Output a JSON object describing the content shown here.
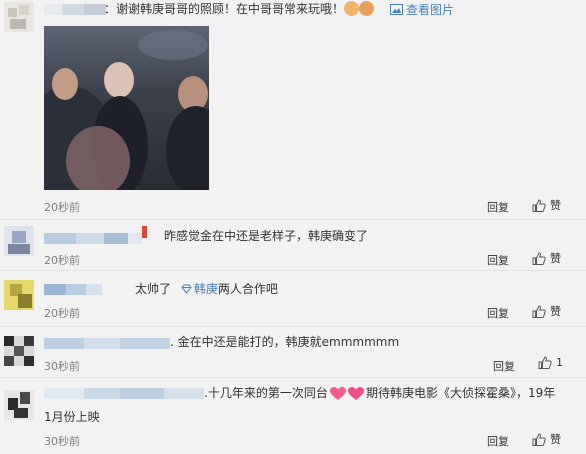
{
  "comments": [
    {
      "text_a": "：谢谢韩庚哥哥的照顾！在中哥哥常来玩哦！",
      "view_pic_label": "查看图片"
    },
    {
      "text": "昨感觉金在中还是老样子，韩庚确变了",
      "time": "20秒前",
      "reply": "回复",
      "like": "赞"
    },
    {
      "text_a": "太帅了",
      "link": "韩庚",
      "text_b": "两人合作吧",
      "time": "20秒前",
      "reply": "回复",
      "like": "赞"
    },
    {
      "text": ". 金在中还是能打的，韩庚就emmmmmm",
      "time": "30秒前",
      "reply": "回复",
      "like": "赞"
    },
    {
      "text": ". 金在中还是能打的，韩庚就emmmmmm",
      "time": "30秒前",
      "reply": "回复",
      "like_count": "1"
    },
    {
      "text_line1_a": ".十几年来的第一次同台",
      "text_line1_b": "期待韩庚电影《大侦探霍桑》，19年",
      "text_line2": "1月份上映",
      "time": "30秒前",
      "reply": "回复",
      "like": "赞"
    }
  ],
  "photo_comment": {
    "time": "20秒前",
    "reply": "回复",
    "like": "赞"
  },
  "colors": {
    "link": "#4a7ebb",
    "meta": "#808080",
    "divider": "#e3e3e3"
  },
  "icons": [
    "thumbs-up-icon",
    "image-icon",
    "heart-icon",
    "emoji-icon",
    "diamond-icon"
  ]
}
